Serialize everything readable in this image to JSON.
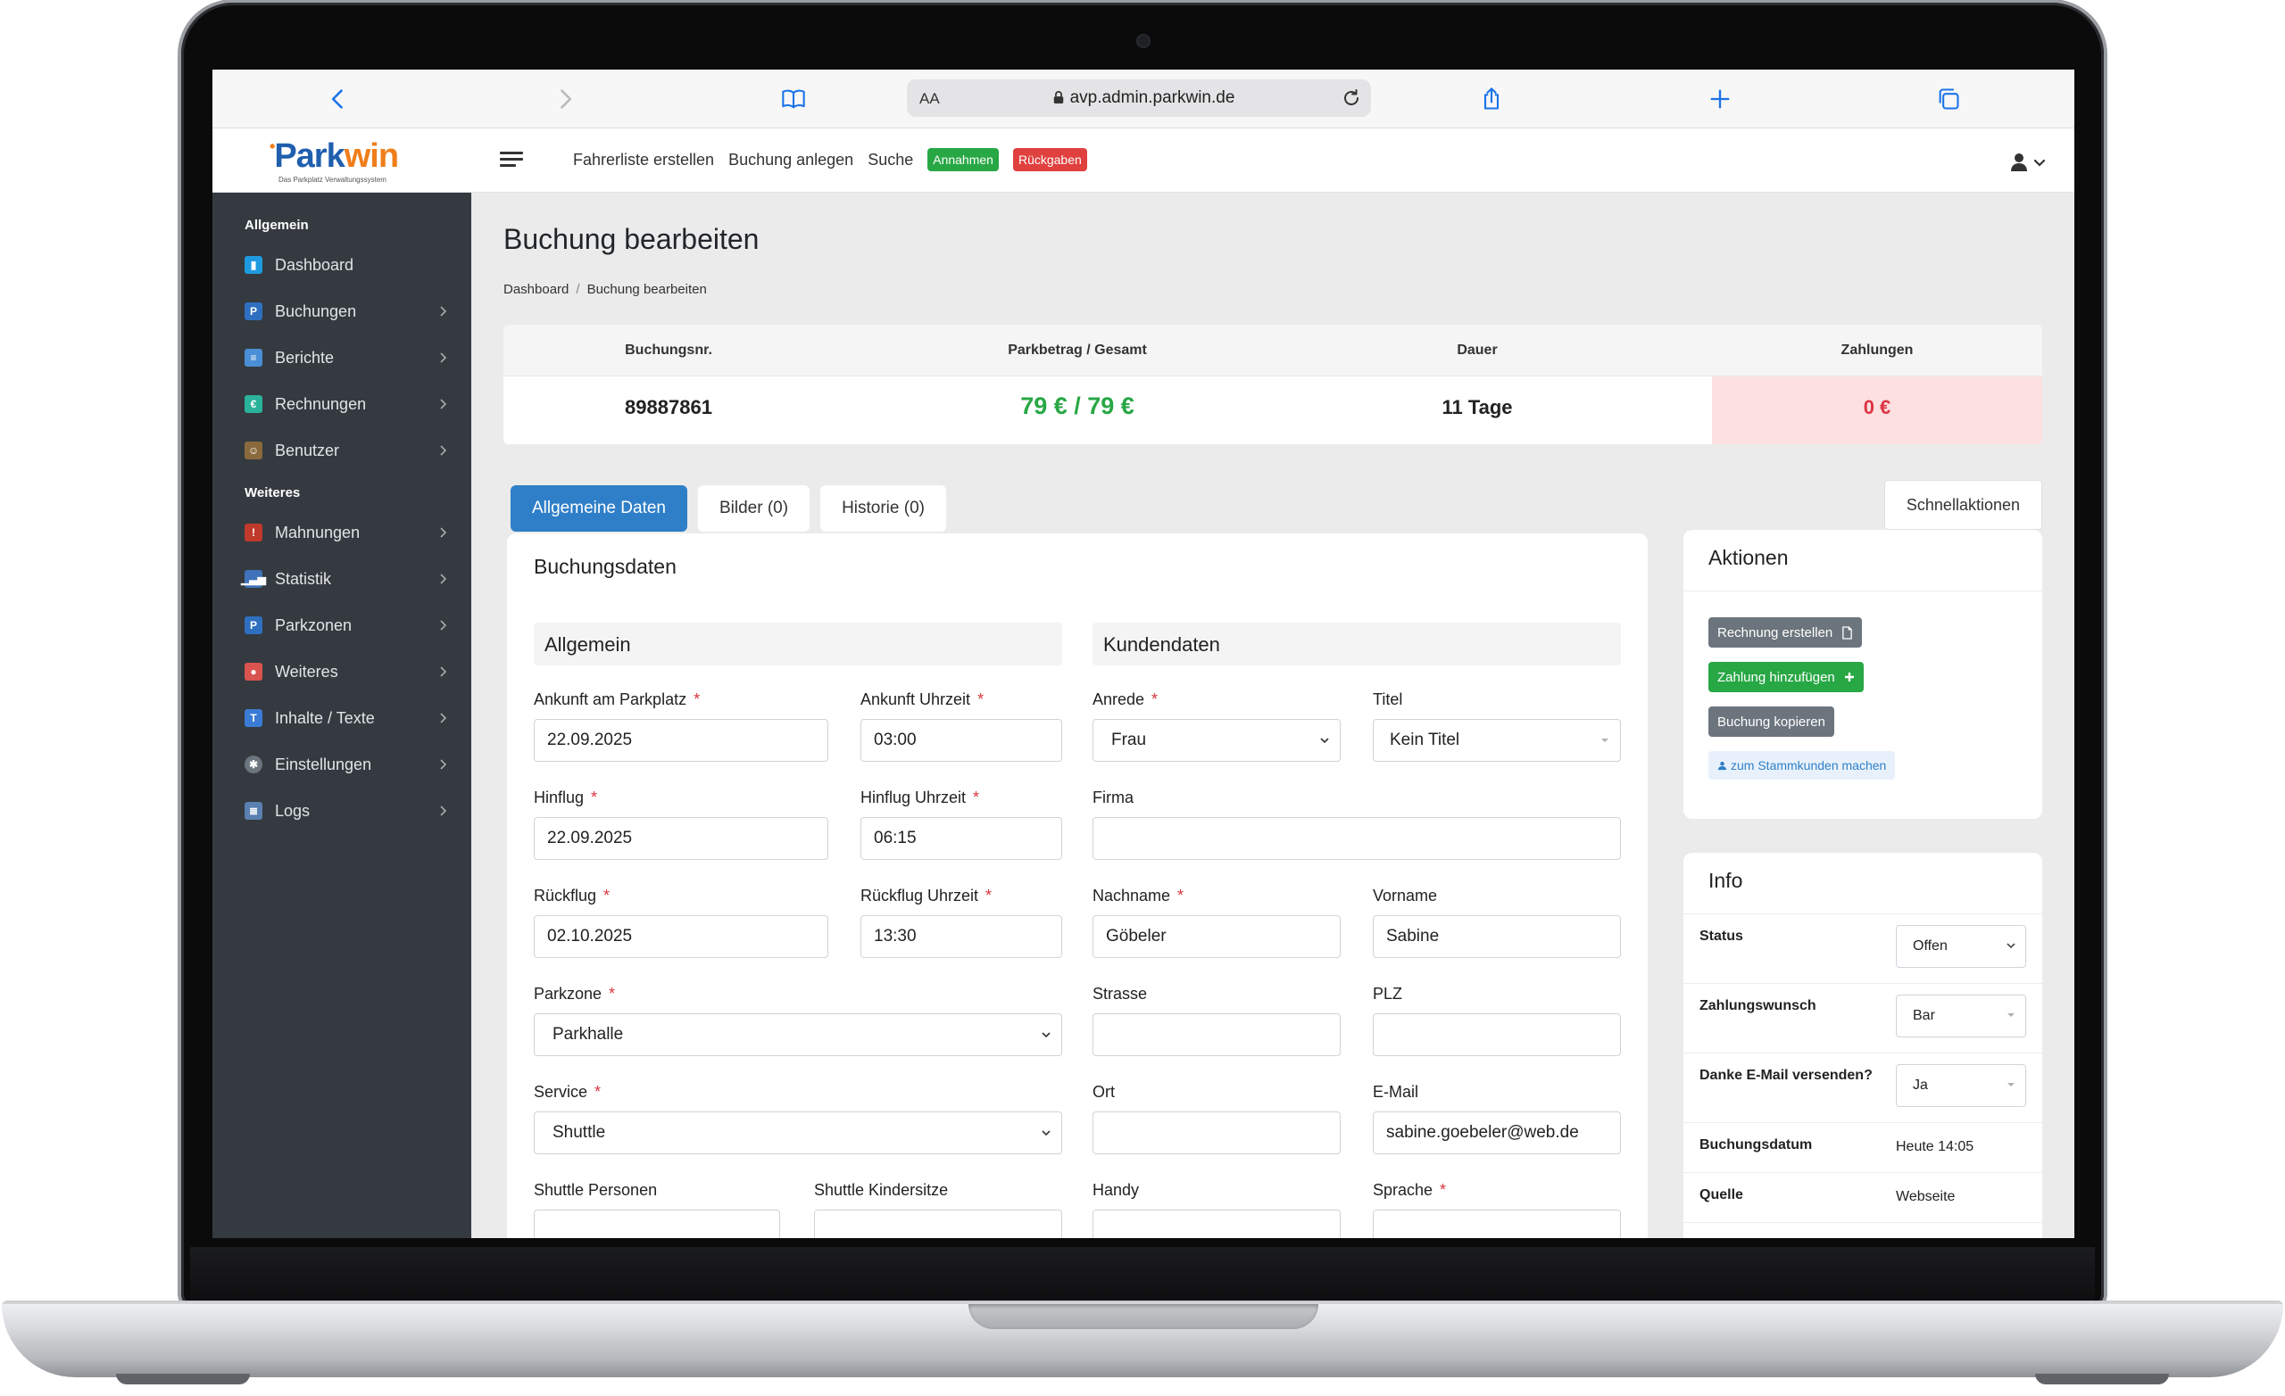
{
  "browser": {
    "text_size_label": "AA",
    "url": "avp.admin.parkwin.de"
  },
  "app": {
    "logo_text": "Parkwin",
    "logo_subtitle": "Das Parkplatz Verwaltungssystem",
    "top_nav": [
      {
        "label": "Fahrerliste erstellen"
      },
      {
        "label": "Buchung anlegen"
      },
      {
        "label": "Suche"
      }
    ],
    "badges": [
      {
        "label": "Annahmen",
        "color": "#28a745"
      },
      {
        "label": "Rückgaben",
        "color": "#e0403e"
      }
    ]
  },
  "sidebar": {
    "section_general": "Allgemein",
    "section_more": "Weiteres",
    "items": [
      {
        "label": "Dashboard",
        "icon": "dashboard-icon"
      },
      {
        "label": "Buchungen",
        "icon": "parking-icon"
      },
      {
        "label": "Berichte",
        "icon": "report-icon"
      },
      {
        "label": "Rechnungen",
        "icon": "invoice-icon"
      },
      {
        "label": "Benutzer",
        "icon": "users-icon"
      },
      {
        "label": "Mahnungen",
        "icon": "reminder-icon"
      },
      {
        "label": "Statistik",
        "icon": "statistics-icon"
      },
      {
        "label": "Parkzonen",
        "icon": "parking-icon"
      },
      {
        "label": "Weiteres",
        "icon": "more-icon"
      },
      {
        "label": "Inhalte / Texte",
        "icon": "text-icon"
      },
      {
        "label": "Einstellungen",
        "icon": "settings-icon"
      },
      {
        "label": "Logs",
        "icon": "logs-icon"
      }
    ]
  },
  "page": {
    "title": "Buchung bearbeiten",
    "breadcrumb": [
      "Dashboard",
      "Buchung bearbeiten"
    ]
  },
  "summary": {
    "headers": [
      "Buchungsnr.",
      "Parkbetrag / Gesamt",
      "Dauer",
      "Zahlungen"
    ],
    "values": [
      "89887861",
      "79 € / 79 €",
      "11 Tage",
      "0 €"
    ]
  },
  "tabs": [
    {
      "label": "Allgemeine Daten",
      "active": true
    },
    {
      "label": "Bilder (0)",
      "active": false
    },
    {
      "label": "Historie (0)",
      "active": false
    }
  ],
  "quick_actions_label": "Schnellaktionen",
  "booking": {
    "title": "Buchungsdaten",
    "general_heading": "Allgemein",
    "customer_heading": "Kundendaten",
    "fields": {
      "arrival_date": {
        "label": "Ankunft am Parkplatz",
        "value": "22.09.2025"
      },
      "arrival_time": {
        "label": "Ankunft Uhrzeit",
        "value": "03:00"
      },
      "outbound_date": {
        "label": "Hinflug",
        "value": "22.09.2025"
      },
      "outbound_time": {
        "label": "Hinflug Uhrzeit",
        "value": "06:15"
      },
      "return_date": {
        "label": "Rückflug",
        "value": "02.10.2025"
      },
      "return_time": {
        "label": "Rückflug Uhrzeit",
        "value": "13:30"
      },
      "zone": {
        "label": "Parkzone",
        "value": "Parkhalle"
      },
      "service": {
        "label": "Service",
        "value": "Shuttle"
      },
      "shuttle_persons": {
        "label": "Shuttle Personen",
        "value": ""
      },
      "shuttle_child_seats": {
        "label": "Shuttle Kindersitze",
        "value": ""
      },
      "salutation": {
        "label": "Anrede",
        "value": "Frau"
      },
      "title": {
        "label": "Titel",
        "value": "Kein Titel"
      },
      "company": {
        "label": "Firma",
        "value": ""
      },
      "last_name": {
        "label": "Nachname",
        "value": "Göbeler"
      },
      "first_name": {
        "label": "Vorname",
        "value": "Sabine"
      },
      "street": {
        "label": "Strasse",
        "value": ""
      },
      "zip": {
        "label": "PLZ",
        "value": ""
      },
      "city": {
        "label": "Ort",
        "value": ""
      },
      "email": {
        "label": "E-Mail",
        "value": "sabine.goebeler@web.de"
      },
      "mobile": {
        "label": "Handy",
        "value": ""
      },
      "language": {
        "label": "Sprache",
        "value": ""
      }
    },
    "required_mark": "*"
  },
  "actions": {
    "title": "Aktionen",
    "create_invoice": "Rechnung erstellen",
    "add_payment": "Zahlung hinzufügen",
    "copy_booking": "Buchung kopieren",
    "make_regular": "zum Stammkunden machen"
  },
  "info": {
    "title": "Info",
    "rows": [
      {
        "key": "Status",
        "value": "Offen"
      },
      {
        "key": "Zahlungswunsch",
        "value": "Bar"
      },
      {
        "key": "Danke E-Mail versenden?",
        "value": "Ja"
      },
      {
        "key": "Buchungsdatum",
        "value": "Heute 14:05"
      },
      {
        "key": "Quelle",
        "value": "Webseite"
      }
    ]
  }
}
